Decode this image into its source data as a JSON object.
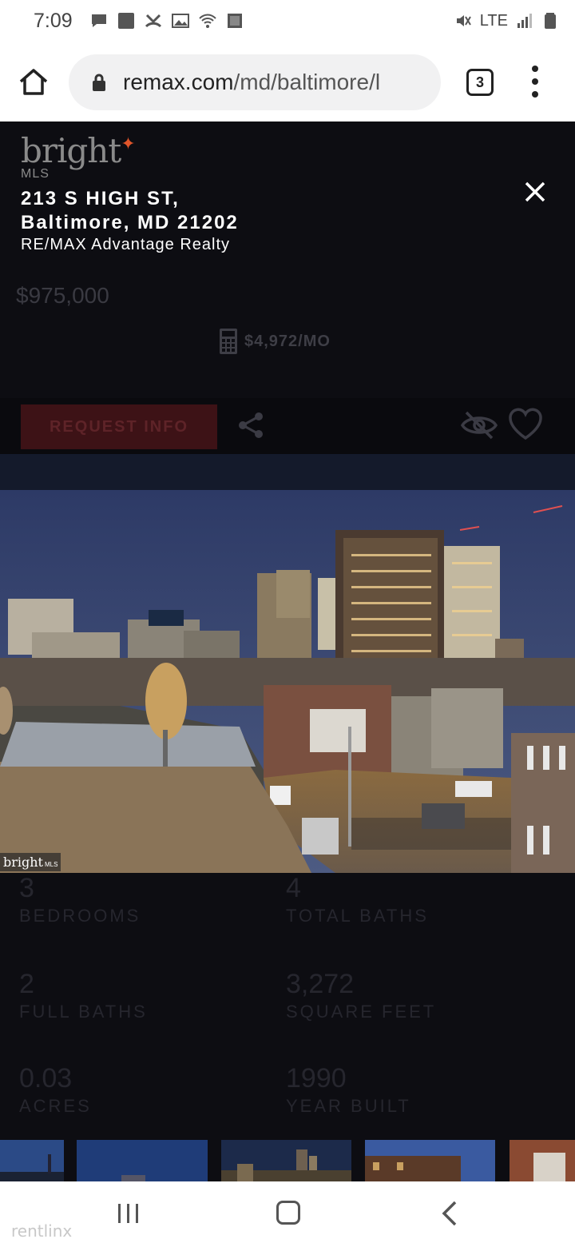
{
  "status_bar": {
    "time": "7:09",
    "network": "LTE",
    "icons_left": [
      "message-icon",
      "square-notification-icon",
      "missed-call-icon",
      "image-icon",
      "wifi-icon",
      "screenshot-icon"
    ],
    "icons_right": [
      "mute-vibrate-icon",
      "signal-icon",
      "battery-icon"
    ]
  },
  "browser": {
    "url_domain": "remax.com",
    "url_path": "/md/baltimore/l",
    "tab_count": "3"
  },
  "listing": {
    "brand_name": "bright",
    "brand_sub": "MLS",
    "address_line1": "213 S HIGH ST,",
    "address_line2": "Baltimore, MD 21202",
    "broker": "RE/MAX Advantage Realty",
    "price": "$975,000",
    "monthly_payment": "$4,972/MO",
    "request_button": "REQUEST INFO",
    "photo_watermark": "bright",
    "photo_watermark_sub": "MLS"
  },
  "stats": [
    {
      "value": "3",
      "label": "BEDROOMS"
    },
    {
      "value": "4",
      "label": "TOTAL BATHS"
    },
    {
      "value": "2",
      "label": "FULL BATHS"
    },
    {
      "value": "3,272",
      "label": "SQUARE FEET"
    },
    {
      "value": "0.03",
      "label": "ACRES"
    },
    {
      "value": "1990",
      "label": "YEAR BUILT"
    }
  ],
  "footer_watermark": "rentlinx",
  "colors": {
    "overlay_bg": "#0d0d12",
    "request_button_bg": "#3d1216",
    "brand_accent": "#e0552a"
  }
}
